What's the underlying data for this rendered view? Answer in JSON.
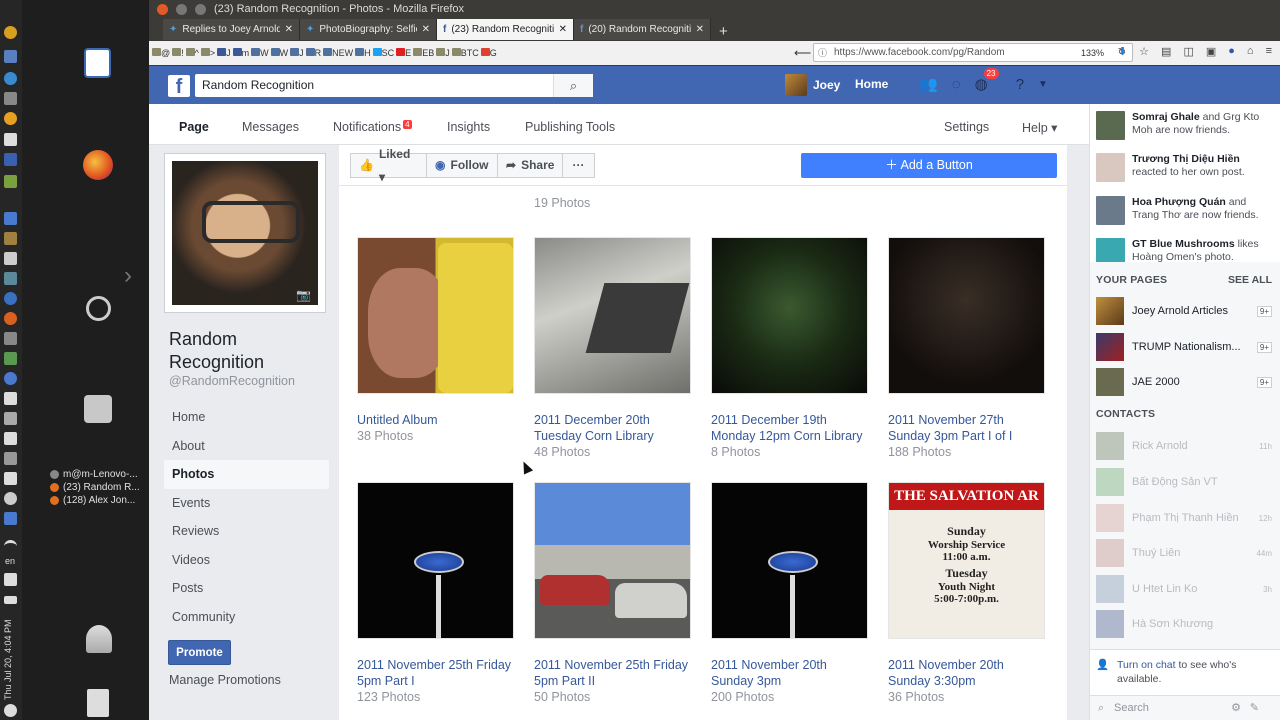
{
  "desktop": {
    "clock": "Thu Jul 20,  4:04 PM",
    "lang": "en",
    "windows": [
      "m@m-Lenovo-...",
      "(23) Random R...",
      "(128) Alex Jon..."
    ]
  },
  "firefox": {
    "window_title": "(23) Random Recognition - Photos - Mozilla Firefox",
    "tabs": [
      {
        "label": "Replies to Joey Arnold",
        "active": false
      },
      {
        "label": "PhotoBiography: Selfie",
        "active": false
      },
      {
        "label": "(23) Random Recogniti",
        "active": true
      },
      {
        "label": "(20) Random Recogniti",
        "active": false
      }
    ],
    "bookmarks": [
      "@",
      "!",
      "^",
      ">",
      "J",
      "m",
      "W",
      "W",
      "J",
      "R",
      "NEW",
      "H",
      "SC",
      "E",
      "EB",
      "J",
      "BTC",
      "G"
    ],
    "url": "https://www.facebook.com/pg/Random",
    "zoom": "133%"
  },
  "fb": {
    "logo": "f",
    "search_value": "Random Recognition",
    "user_name": "Joey",
    "home_label": "Home",
    "notif_count": "23",
    "colors": {
      "brand": "#4267b2",
      "link": "#365899",
      "accent": "#4080ff"
    }
  },
  "pagetabs": {
    "page": "Page",
    "messages": "Messages",
    "notifications": "Notifications",
    "notifications_badge": "4",
    "insights": "Insights",
    "publishing": "Publishing Tools",
    "settings": "Settings",
    "help": "Help ▾"
  },
  "page": {
    "name": "Random Recognition",
    "handle": "@RandomRecognition",
    "nav": [
      "Home",
      "About",
      "Photos",
      "Events",
      "Reviews",
      "Videos",
      "Posts",
      "Community"
    ],
    "promote": "Promote",
    "manage": "Manage Promotions"
  },
  "actions": {
    "liked": "Liked ▾",
    "follow": "Follow",
    "share": "Share",
    "more": "···",
    "add_button": "Add a Button"
  },
  "prev_row": {
    "count": "19 Photos"
  },
  "albums": [
    {
      "title": "Untitled Album",
      "count": "38 Photos"
    },
    {
      "title": "2011 December 20th Tuesday Corn Library",
      "count": "48 Photos"
    },
    {
      "title": "2011 December 19th Monday 12pm Corn Library",
      "count": "8 Photos"
    },
    {
      "title": "2011 November 27th Sunday 3pm Part I of I",
      "count": "188 Photos"
    },
    {
      "title": "2011 November 25th Friday 5pm Part I",
      "count": "123 Photos"
    },
    {
      "title": "2011 November 25th Friday 5pm Part II",
      "count": "50 Photos"
    },
    {
      "title": "2011 November 20th Sunday 3pm",
      "count": "200 Photos"
    },
    {
      "title": "2011 November 20th Sunday 3:30pm",
      "count": "36 Photos"
    }
  ],
  "sign": {
    "line1": "THE SALVATION AR",
    "line2": "Sunday",
    "line3": "Worship Service",
    "line4": "11:00 a.m.",
    "line5": "Tuesday",
    "line6": "Youth Night",
    "line7": "5:00-7:00p.m."
  },
  "ticker": [
    {
      "name": "Somraj Ghale",
      "text": " and Grg Kto Moh are now friends."
    },
    {
      "name": "Trương Thị Diệu Hiền",
      "text": " reacted to her own post."
    },
    {
      "name": "Hoa Phượng Quán",
      "text": " and Trang Thơ are now friends."
    },
    {
      "name": "GT Blue Mushrooms",
      "text": " likes Hoàng Omen's photo."
    }
  ],
  "your_pages": {
    "header": "YOUR PAGES",
    "see_all": "SEE ALL",
    "items": [
      {
        "name": "Joey Arnold Articles",
        "badge": "9+"
      },
      {
        "name": "TRUMP Nationalism...",
        "badge": "9+"
      },
      {
        "name": "JAE 2000",
        "badge": "9+"
      }
    ]
  },
  "contacts": {
    "header": "CONTACTS",
    "items": [
      {
        "name": "Rick Arnold",
        "time": "11h"
      },
      {
        "name": "Bất Động Sản VT",
        "time": ""
      },
      {
        "name": "Phạm Thị Thanh Hiền",
        "time": "12h"
      },
      {
        "name": "Thuý Liên",
        "time": "44m"
      },
      {
        "name": "U Htet Lin Ko",
        "time": "3h"
      },
      {
        "name": "Hà Sơn Khương",
        "time": ""
      }
    ]
  },
  "chat": {
    "turn_on": "Turn on chat",
    "rest": " to see who's available.",
    "search_placeholder": "Search"
  }
}
